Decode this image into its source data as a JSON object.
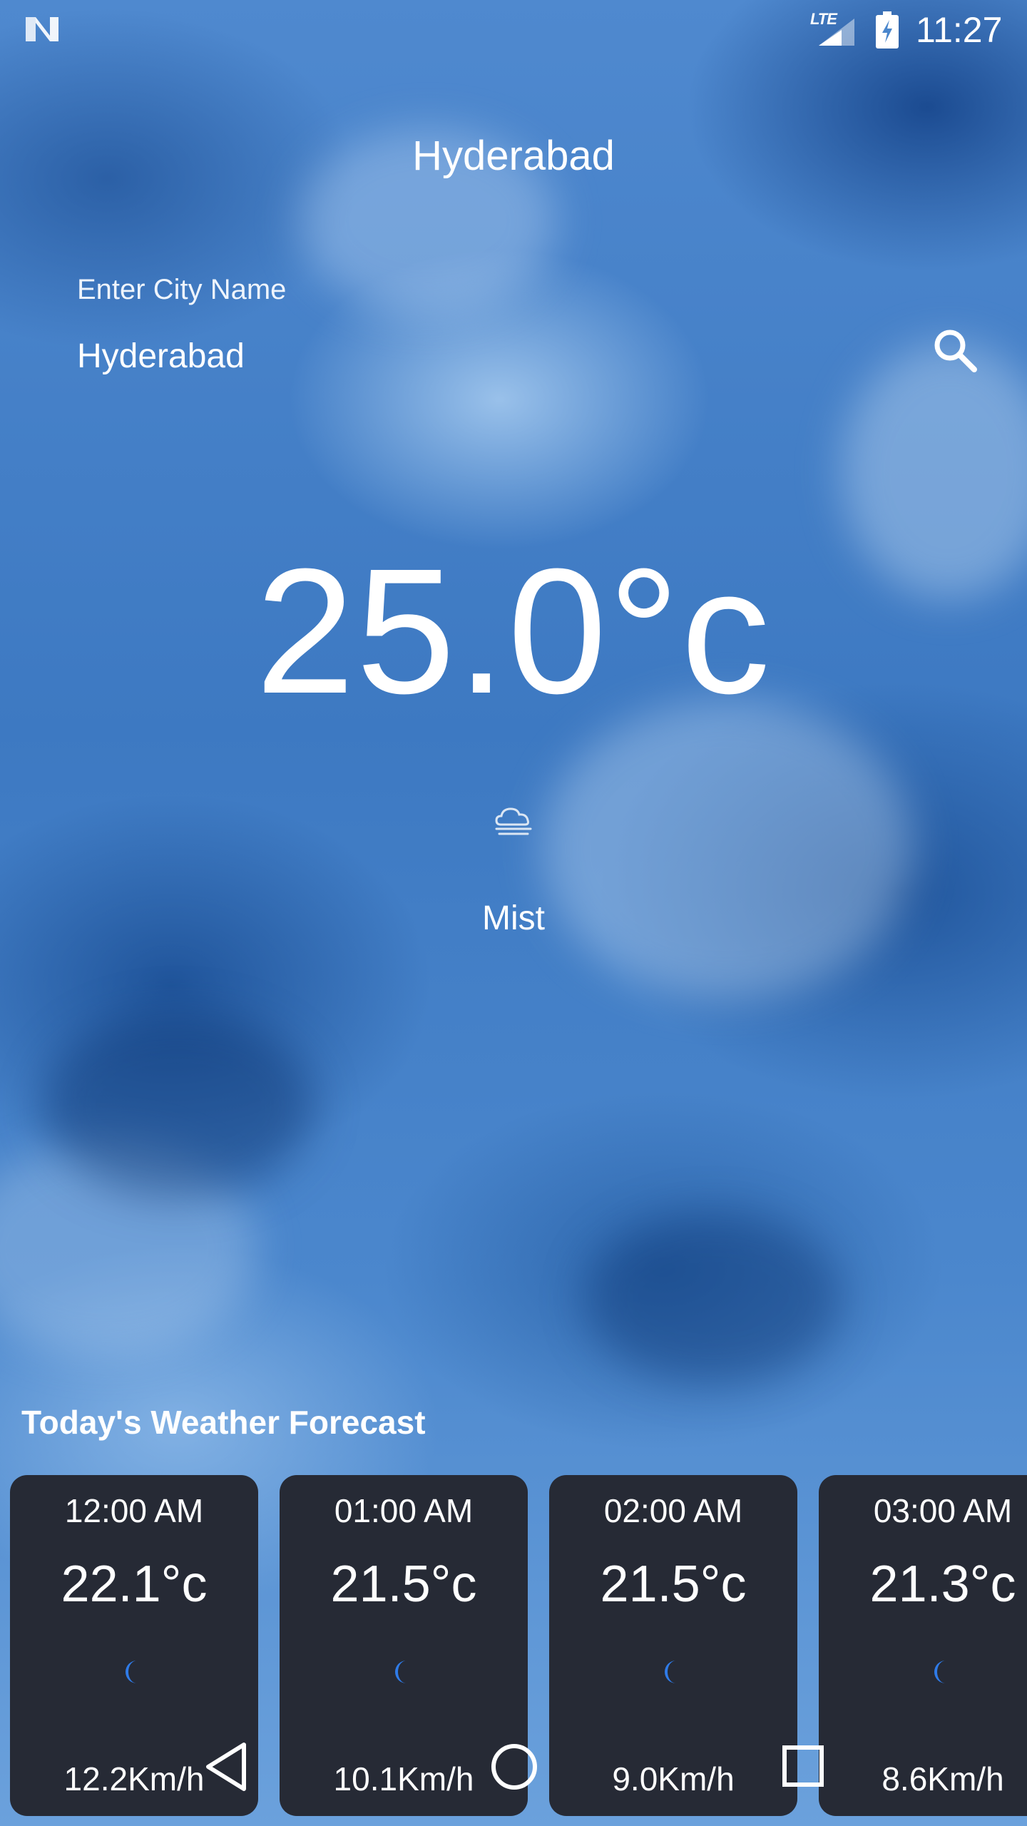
{
  "status_bar": {
    "network_label": "LTE",
    "time": "11:27",
    "icons": [
      "notification-n-icon",
      "lte-signal-icon",
      "battery-charging-icon"
    ]
  },
  "city_title": "Hyderabad",
  "search": {
    "label": "Enter City Name",
    "value": "Hyderabad",
    "icon": "search-icon"
  },
  "current": {
    "temperature": "25.0°c",
    "condition": "Mist",
    "condition_icon": "mist-cloud-icon"
  },
  "forecast": {
    "title": "Today's Weather Forecast",
    "cards": [
      {
        "time": "12:00 AM",
        "temp": "22.1°c",
        "icon": "moon-icon",
        "wind": "12.2Km/h"
      },
      {
        "time": "01:00 AM",
        "temp": "21.5°c",
        "icon": "moon-icon",
        "wind": "10.1Km/h"
      },
      {
        "time": "02:00 AM",
        "temp": "21.5°c",
        "icon": "moon-icon",
        "wind": "9.0Km/h"
      },
      {
        "time": "03:00 AM",
        "temp": "21.3°c",
        "icon": "moon-icon",
        "wind": "8.6Km/h"
      }
    ]
  },
  "nav_bar": {
    "icons": [
      "back-icon",
      "home-icon",
      "recents-icon"
    ]
  },
  "colors": {
    "card_background": "#262a35",
    "moon": "#2f7be8",
    "text": "#ffffff",
    "sky": "#4a86cc"
  }
}
